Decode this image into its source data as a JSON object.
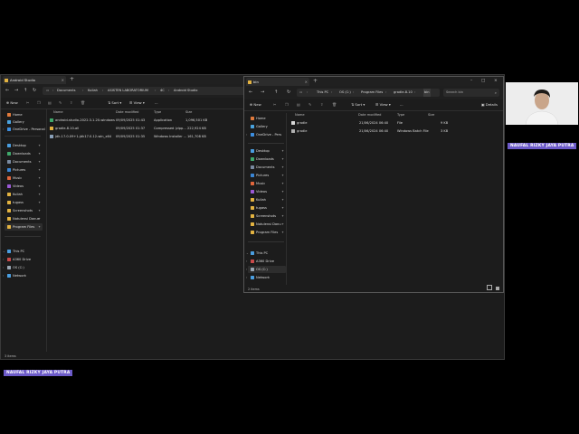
{
  "window_a": {
    "tab_title": "Android Studio",
    "address": [
      "Documents",
      "Kuliah",
      "ASISTEN LABORATORIUM",
      "4C",
      "Android Studio"
    ],
    "commands": {
      "new": "New",
      "sort": "Sort",
      "view": "View",
      "more": "..."
    },
    "sidebar": {
      "top": [
        {
          "label": "Home",
          "icon_color": "#e07a3c"
        },
        {
          "label": "Gallery",
          "icon_color": "#4aa3df"
        },
        {
          "label": "OneDrive - Personal",
          "icon_color": "#3c8ee0"
        }
      ],
      "quick": [
        {
          "label": "Desktop",
          "icon_color": "#4a9ee0"
        },
        {
          "label": "Downloads",
          "icon_color": "#3fa86b"
        },
        {
          "label": "Documents",
          "icon_color": "#7a8aa0"
        },
        {
          "label": "Pictures",
          "icon_color": "#3a86d6"
        },
        {
          "label": "Music",
          "icon_color": "#e0663c"
        },
        {
          "label": "Videos",
          "icon_color": "#9b59d6"
        },
        {
          "label": "Kuliah",
          "icon_color": "#e3b341"
        },
        {
          "label": "tugass",
          "icon_color": "#e3b341"
        },
        {
          "label": "Screenshots",
          "icon_color": "#e3b341"
        },
        {
          "label": "Notulensi Danus",
          "icon_color": "#e3b341"
        },
        {
          "label": "Program Files",
          "icon_color": "#e3b341"
        }
      ],
      "drives": [
        {
          "label": "This PC",
          "icon_color": "#4a9ee0"
        },
        {
          "label": "A360 Drive",
          "icon_color": "#c94a4a"
        },
        {
          "label": "OS (C:)",
          "icon_color": "#9aa6b2"
        },
        {
          "label": "Network",
          "icon_color": "#4a9ee0"
        }
      ]
    },
    "columns": [
      "Name",
      "Date modified",
      "Type",
      "Size"
    ],
    "files": [
      {
        "name": "android-studio-2022.3.1.20-windows",
        "date": "09/09/2025 01:43",
        "type": "Application",
        "size": "1,096,501 KB",
        "icon_color": "#3fa86b"
      },
      {
        "name": "gradle-8.10-all",
        "date": "09/09/2025 01:37",
        "type": "Compressed (zipp...",
        "size": "222,924 KB",
        "icon_color": "#e3b341"
      },
      {
        "name": "jdk-17.0.09+1-jdk17.0.12-win_x64",
        "date": "09/09/2025 01:35",
        "type": "Windows Installer ...",
        "size": "161,708 KB",
        "icon_color": "#8aa0b8"
      }
    ],
    "status": "3 items"
  },
  "window_b": {
    "tab_title": "bin",
    "address": [
      "This PC",
      "OS (C:)",
      "Program Files",
      "gradle-8.10",
      "bin"
    ],
    "search_placeholder": "Search bin",
    "commands": {
      "new": "New",
      "sort": "Sort",
      "view": "View",
      "more": "...",
      "details": "Details"
    },
    "sidebar": {
      "top": [
        {
          "label": "Home",
          "icon_color": "#e07a3c"
        },
        {
          "label": "Gallery",
          "icon_color": "#4aa3df"
        },
        {
          "label": "OneDrive - Pers",
          "icon_color": "#3c8ee0"
        }
      ],
      "quick": [
        {
          "label": "Desktop",
          "icon_color": "#4a9ee0"
        },
        {
          "label": "Downloads",
          "icon_color": "#3fa86b"
        },
        {
          "label": "Documents",
          "icon_color": "#7a8aa0"
        },
        {
          "label": "Pictures",
          "icon_color": "#3a86d6"
        },
        {
          "label": "Music",
          "icon_color": "#e0663c"
        },
        {
          "label": "Videos",
          "icon_color": "#9b59d6"
        },
        {
          "label": "Kuliah",
          "icon_color": "#e3b341"
        },
        {
          "label": "tugass",
          "icon_color": "#e3b341"
        },
        {
          "label": "Screenshots",
          "icon_color": "#e3b341"
        },
        {
          "label": "Notulensi Danu",
          "icon_color": "#e3b341"
        },
        {
          "label": "Program Files",
          "icon_color": "#e3b341"
        }
      ],
      "drives": [
        {
          "label": "This PC",
          "icon_color": "#4a9ee0"
        },
        {
          "label": "A360 Drive",
          "icon_color": "#c94a4a"
        },
        {
          "label": "OS (C:)",
          "icon_color": "#9aa6b2"
        },
        {
          "label": "Network",
          "icon_color": "#4a9ee0"
        }
      ]
    },
    "columns": [
      "Name",
      "Date modified",
      "Type",
      "Size"
    ],
    "files": [
      {
        "name": "gradle",
        "date": "21/06/2024 06:40",
        "type": "File",
        "size": "9 KB",
        "icon_color": "#d8d8d8"
      },
      {
        "name": "gradle",
        "date": "21/06/2024 06:40",
        "type": "Windows Batch File",
        "size": "3 KB",
        "icon_color": "#b0b0b0"
      }
    ],
    "status": "2 items"
  },
  "name_badge": "NAUFAL RIZKY JAYA PUTRA"
}
